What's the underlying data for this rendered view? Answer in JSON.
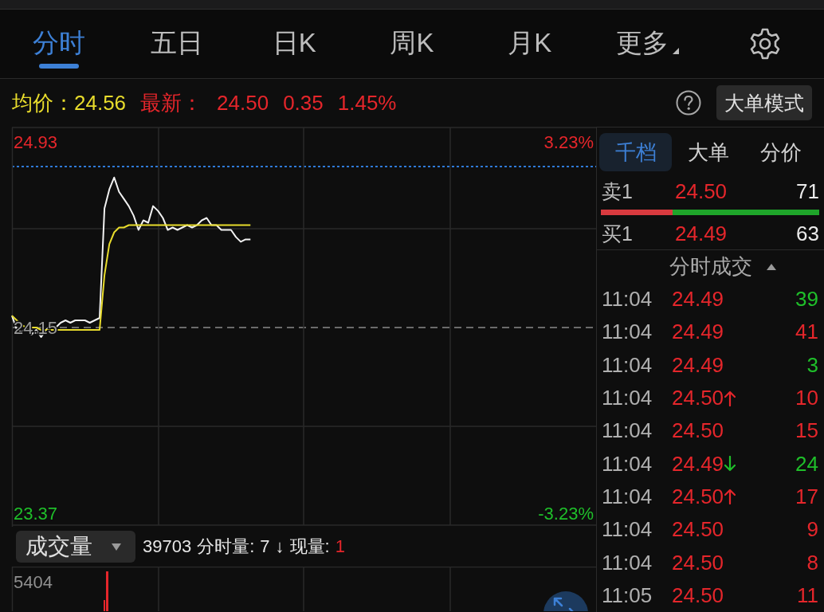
{
  "tabs": [
    {
      "label": "分时",
      "selected": true,
      "kind": "view"
    },
    {
      "label": "五日",
      "selected": false,
      "kind": "view"
    },
    {
      "label": "日K",
      "selected": false,
      "kind": "view"
    },
    {
      "label": "周K",
      "selected": false,
      "kind": "view"
    },
    {
      "label": "月K",
      "selected": false,
      "kind": "view"
    },
    {
      "label": "更多",
      "selected": false,
      "kind": "menu"
    }
  ],
  "quote": {
    "avg_label": "均价：",
    "avg_value": "24.56",
    "last_label": "最新：",
    "last_value": "24.50",
    "change": "0.35",
    "change_percent": "1.45%",
    "mode_button": "大单模式"
  },
  "price_chart": {
    "chart_data": {
      "type": "line",
      "categories": [
        null,
        null,
        null,
        null,
        null,
        null,
        null,
        null,
        null,
        null,
        null,
        null,
        null,
        null,
        null,
        null,
        null,
        null,
        null,
        null,
        null,
        null,
        null,
        null,
        null,
        null,
        null,
        null,
        null,
        null,
        null,
        null,
        null,
        null,
        null,
        null,
        null,
        null,
        null,
        null,
        null,
        null,
        null,
        null,
        null,
        null,
        null,
        null,
        null,
        null,
        null,
        null,
        null,
        null,
        null,
        null,
        null,
        null,
        null,
        null,
        null,
        null,
        null,
        null,
        null,
        null,
        null,
        null,
        null,
        null,
        null,
        null,
        null,
        null,
        null,
        null,
        null,
        null,
        null,
        null,
        null,
        null,
        null,
        null,
        null,
        null,
        null,
        null,
        null,
        null,
        null,
        null,
        null,
        null,
        null,
        null,
        null,
        null,
        null,
        null,
        null,
        null,
        null,
        null,
        null,
        null,
        null,
        null,
        null,
        null,
        null,
        null,
        null,
        null,
        null,
        null,
        null,
        null,
        null,
        null,
        null
      ],
      "series": [
        {
          "color": "#f2f2f2",
          "values": [
            24.2,
            24.14,
            24.13,
            24.15,
            24.12,
            24.14,
            24.11,
            24.14,
            24.16,
            24.15,
            24.17,
            24.18,
            24.17,
            24.18,
            24.18,
            24.18,
            24.17,
            24.18,
            24.19,
            24.65,
            24.73,
            24.78,
            24.72,
            24.69,
            24.66,
            24.62,
            24.56,
            24.6,
            24.59,
            24.66,
            24.64,
            24.61,
            24.56,
            24.57,
            24.56,
            24.57,
            24.58,
            24.57,
            24.58,
            24.6,
            24.61,
            24.58,
            24.58,
            24.56,
            24.56,
            24.56,
            24.53,
            24.51,
            24.52,
            24.52,
            null,
            null,
            null,
            null,
            null,
            null,
            null,
            null,
            null,
            null,
            null,
            null,
            null,
            null,
            null,
            null,
            null,
            null,
            null,
            null,
            null,
            null,
            null,
            null,
            null,
            null,
            null,
            null,
            null,
            null,
            null,
            null,
            null,
            null,
            null,
            null,
            null,
            null,
            null,
            null,
            null,
            null,
            null,
            null,
            null,
            null,
            null,
            null,
            null,
            null,
            null,
            null,
            null,
            null,
            null,
            null,
            null,
            null,
            null,
            null,
            null,
            null,
            null,
            null,
            null,
            null,
            null,
            null,
            null,
            null,
            null
          ]
        },
        {
          "color": "#e8dc2c",
          "values": [
            24.2,
            24.18,
            24.16,
            24.15,
            24.15,
            24.15,
            24.14,
            24.14,
            24.14,
            24.14,
            24.14,
            24.14,
            24.14,
            24.14,
            24.14,
            24.14,
            24.14,
            24.14,
            24.14,
            24.37,
            24.5,
            24.55,
            24.57,
            24.57,
            24.58,
            24.58,
            24.58,
            24.58,
            24.58,
            24.58,
            24.58,
            24.58,
            24.58,
            24.58,
            24.58,
            24.58,
            24.58,
            24.58,
            24.58,
            24.58,
            24.58,
            24.58,
            24.58,
            24.58,
            24.58,
            24.58,
            24.58,
            24.58,
            24.58,
            24.58,
            null,
            null,
            null,
            null,
            null,
            null,
            null,
            null,
            null,
            null,
            null,
            null,
            null,
            null,
            null,
            null,
            null,
            null,
            null,
            null,
            null,
            null,
            null,
            null,
            null,
            null,
            null,
            null,
            null,
            null,
            null,
            null,
            null,
            null,
            null,
            null,
            null,
            null,
            null,
            null,
            null,
            null,
            null,
            null,
            null,
            null,
            null,
            null,
            null,
            null,
            null,
            null,
            null,
            null,
            null,
            null,
            null,
            null,
            null,
            null,
            null,
            null,
            null,
            null,
            null,
            null,
            null,
            null,
            null,
            null,
            null
          ]
        }
      ],
      "ylim": [
        23.32,
        24.99
      ],
      "yticks": [
        {
          "value": 24.93,
          "label": "24.93"
        },
        {
          "value": 24.15,
          "label": "24.15"
        },
        {
          "value": 23.37,
          "label": "23.37"
        }
      ]
    },
    "percent_labels": [
      {
        "text": "3.23%",
        "color": "#e5262b"
      },
      {
        "text": "-3.23%",
        "color": "#1fbf2a"
      }
    ]
  },
  "volume_panel": {
    "indicator": "成交量",
    "total": "39703",
    "minute_label": "分时量:",
    "minute_value": "7",
    "trend_arrow": "↓",
    "current_label": "现量:",
    "current_value": "1",
    "max_label": "5404"
  },
  "side_panel": {
    "tabs": [
      {
        "label": "千档",
        "selected": true
      },
      {
        "label": "大单",
        "selected": false
      },
      {
        "label": "分价",
        "selected": false
      }
    ],
    "order_book": {
      "ask": {
        "label": "卖1",
        "price": "24.50",
        "volume": "71"
      },
      "bid": {
        "label": "买1",
        "price": "24.49",
        "volume": "63"
      },
      "level": 0.33
    },
    "trades_header": "分时成交",
    "trades": [
      {
        "time": "11:04",
        "price": "24.49",
        "kind": "plain",
        "volume": "39",
        "color": "#1fbf2a"
      },
      {
        "time": "11:04",
        "price": "24.49",
        "kind": "plain",
        "volume": "41",
        "color": "#e5262b"
      },
      {
        "time": "11:04",
        "price": "24.49",
        "kind": "plain",
        "volume": "3",
        "color": "#1fbf2a"
      },
      {
        "time": "11:04",
        "price": "24.50",
        "kind": "up",
        "volume": "10",
        "color": "#e5262b"
      },
      {
        "time": "11:04",
        "price": "24.50",
        "kind": "plain",
        "volume": "15",
        "color": "#e5262b"
      },
      {
        "time": "11:04",
        "price": "24.49",
        "kind": "down",
        "volume": "24",
        "color": "#1fbf2a"
      },
      {
        "time": "11:04",
        "price": "24.50",
        "kind": "up",
        "volume": "17",
        "color": "#e5262b"
      },
      {
        "time": "11:04",
        "price": "24.50",
        "kind": "plain",
        "volume": "9",
        "color": "#e5262b"
      },
      {
        "time": "11:04",
        "price": "24.50",
        "kind": "plain",
        "volume": "8",
        "color": "#e5262b"
      },
      {
        "time": "11:05",
        "price": "24.50",
        "kind": "plain",
        "volume": "11",
        "color": "#e5262b"
      }
    ]
  }
}
